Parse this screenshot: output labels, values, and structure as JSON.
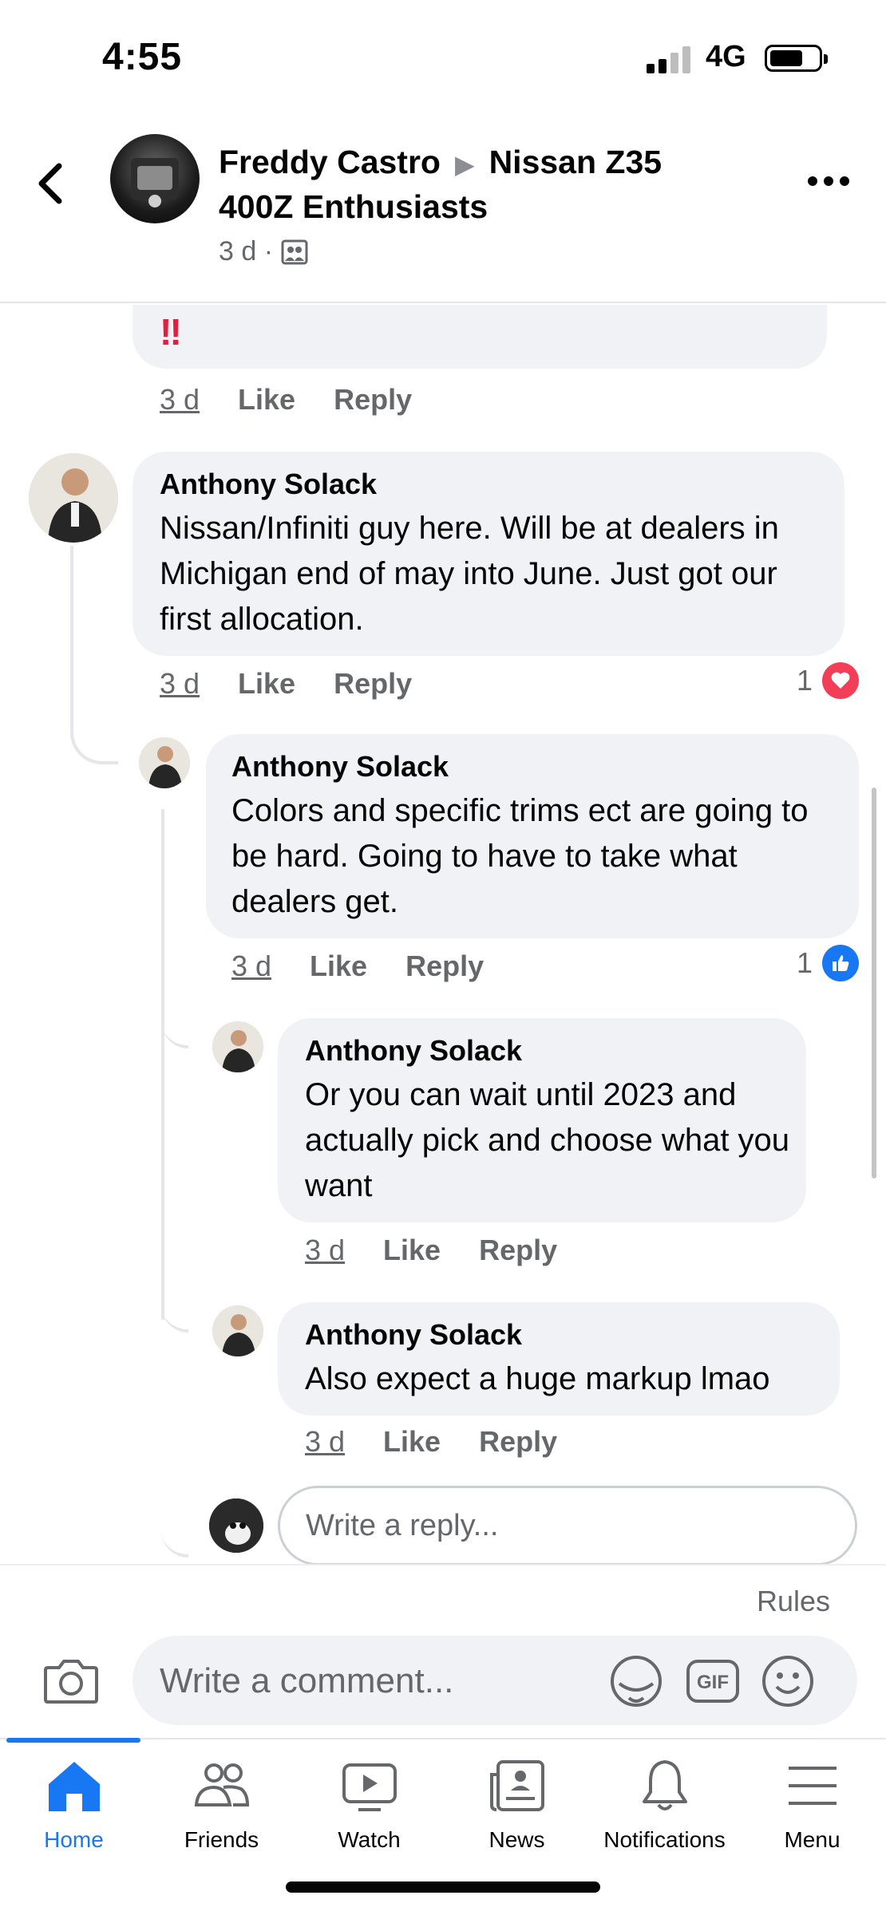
{
  "status_bar": {
    "time": "4:55",
    "network": "4G"
  },
  "header": {
    "author": "Freddy Castro",
    "group_line1": "Nissan Z35",
    "group_line2": "400Z Enthusiasts",
    "post_time": "3 d ·",
    "privacy_icon": "group-members-icon"
  },
  "top_comment": {
    "emoji": "‼",
    "time": "3 d",
    "like": "Like",
    "reply": "Reply"
  },
  "comments": [
    {
      "name": "Anthony Solack",
      "text": "Nissan/Infiniti guy here. Will be at dealers in Michigan end of may into June. Just got our first allocation.",
      "time": "3 d",
      "like": "Like",
      "reply": "Reply",
      "reaction_count": "1",
      "reaction_icon": "love-reaction-icon",
      "reaction_color": "#f33e58"
    },
    {
      "name": "Anthony Solack",
      "text": "Colors and specific trims ect are going to be hard. Going to have to take what dealers get.",
      "time": "3 d",
      "like": "Like",
      "reply": "Reply",
      "reaction_count": "1",
      "reaction_icon": "like-reaction-icon",
      "reaction_color": "#1877f2"
    },
    {
      "name": "Anthony Solack",
      "text": "Or you can wait until 2023 and actually pick and choose what you want",
      "time": "3 d",
      "like": "Like",
      "reply": "Reply"
    },
    {
      "name": "Anthony Solack",
      "text": "Also expect a huge markup lmao",
      "time": "3 d",
      "like": "Like",
      "reply": "Reply"
    }
  ],
  "reply_box": {
    "placeholder": "Write a reply..."
  },
  "composer": {
    "rules": "Rules",
    "placeholder": "Write a comment...",
    "gif_label": "GIF"
  },
  "tabs": [
    {
      "label": "Home",
      "icon": "home-icon",
      "active": true
    },
    {
      "label": "Friends",
      "icon": "friends-icon"
    },
    {
      "label": "Watch",
      "icon": "watch-icon"
    },
    {
      "label": "News",
      "icon": "news-icon"
    },
    {
      "label": "Notifications",
      "icon": "bell-icon"
    },
    {
      "label": "Menu",
      "icon": "menu-icon"
    }
  ],
  "colors": {
    "accent": "#1877f2",
    "bubble": "#f0f2f5",
    "secondary_text": "#65676b"
  }
}
